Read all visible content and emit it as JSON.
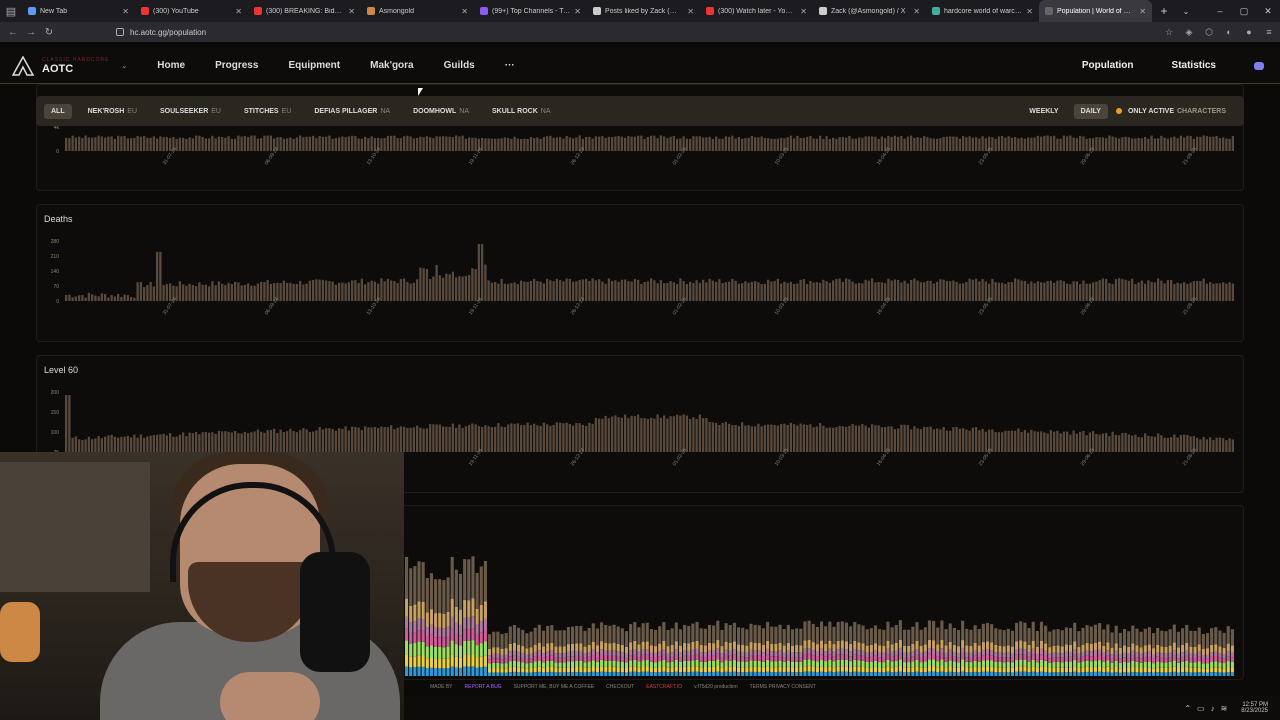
{
  "browser": {
    "tabs": [
      {
        "title": "New Tab",
        "color": "#5b9cf2",
        "active": false
      },
      {
        "title": "(300) YouTube",
        "color": "#e33",
        "active": false
      },
      {
        "title": "(300) BREAKING: Biden aide de",
        "color": "#e33",
        "active": false
      },
      {
        "title": "Asmongold",
        "color": "#c84",
        "active": false
      },
      {
        "title": "(99+) Top Channels - Twitch",
        "color": "#8a5cf5",
        "active": false
      },
      {
        "title": "Posts liked by Zack (@Asmong",
        "color": "#ccc",
        "active": false
      },
      {
        "title": "(300) Watch later - YouTube",
        "color": "#e33",
        "active": false
      },
      {
        "title": "Zack (@Asmongold) / X",
        "color": "#ccc",
        "active": false
      },
      {
        "title": "hardcore world of warcraft pop",
        "color": "#4a9",
        "active": false
      },
      {
        "title": "Population | World of Warcraft",
        "color": "#666",
        "active": true
      }
    ],
    "url": "hc.aotc.gg/population"
  },
  "site": {
    "logo_sub": "CLASSIC HARDCORE",
    "logo_name": "AOTC",
    "nav": [
      "Home",
      "Progress",
      "Equipment",
      "Mak'gora",
      "Guilds"
    ],
    "nav_more": "···",
    "nav_right": [
      "Population",
      "Statistics"
    ]
  },
  "filters": {
    "realms": [
      {
        "label": "ALL",
        "region": "",
        "active": true
      },
      {
        "label": "NEK'ROSH",
        "region": "EU",
        "active": false
      },
      {
        "label": "SOULSEEKER",
        "region": "EU",
        "active": false
      },
      {
        "label": "STITCHES",
        "region": "EU",
        "active": false
      },
      {
        "label": "DEFIAS PILLAGER",
        "region": "NA",
        "active": false
      },
      {
        "label": "DOOMHOWL",
        "region": "NA",
        "active": false
      },
      {
        "label": "SKULL ROCK",
        "region": "NA",
        "active": false
      }
    ],
    "weekly": "WEEKLY",
    "daily": "DAILY",
    "only_active": "ONLY ACTIVE",
    "characters": "CHARACTERS"
  },
  "chart_data": [
    {
      "type": "bar",
      "title": "",
      "yticks": [
        "4k",
        "0"
      ],
      "xticks": [
        "31-07-24",
        "06-09-24",
        "13-10-24",
        "19-11-24",
        "26-12-24",
        "01-02-25",
        "10-03-25",
        "16-04-25",
        "23-05-25",
        "29-06-25",
        "21-08-25"
      ],
      "bar_color": "#5a4a3e"
    },
    {
      "type": "bar",
      "title": "Deaths",
      "yticks": [
        "280",
        "210",
        "140",
        "70",
        "0"
      ],
      "ylim": [
        0,
        280
      ],
      "xticks": [
        "31-07-24",
        "06-09-24",
        "13-10-24",
        "19-11-24",
        "26-12-24",
        "01-02-25",
        "10-03-25",
        "16-04-25",
        "23-05-25",
        "29-06-25",
        "21-08-25"
      ],
      "bar_color": "#5a4a3e",
      "peaks": [
        {
          "x": "13-08-24",
          "y": 230
        },
        {
          "x": "19-11-24",
          "y": 270
        }
      ]
    },
    {
      "type": "bar",
      "title": "Level 60",
      "yticks": [
        "200",
        "150",
        "100",
        "75"
      ],
      "ylim": [
        0,
        200
      ],
      "xticks": [
        "19-11-24",
        "26-12-24",
        "01-02-25",
        "10-03-25",
        "16-04-25",
        "23-05-25",
        "29-06-25",
        "21-08-25"
      ],
      "bar_color": "#5a4a3e"
    },
    {
      "type": "bar",
      "title": "",
      "stacked": true,
      "colors": [
        "#2a9ad8",
        "#e8d040",
        "#9ae060",
        "#d05a9a",
        "#b07aa0",
        "#c8a060",
        "#6a5a4a"
      ]
    }
  ],
  "footer": {
    "made_by": "MADE BY",
    "report": "REPORT A BUG",
    "support": "SUPPORT ME, BUY ME A COFFEE",
    "checkout": "CHECKOUT",
    "checkout_link": "EASTCRAFT.IO",
    "version": "v.f75d20 production",
    "links": "TERMS  PRIVACY  CONSENT"
  },
  "taskbar": {
    "time": "12:57 PM",
    "date": "8/23/2025"
  }
}
